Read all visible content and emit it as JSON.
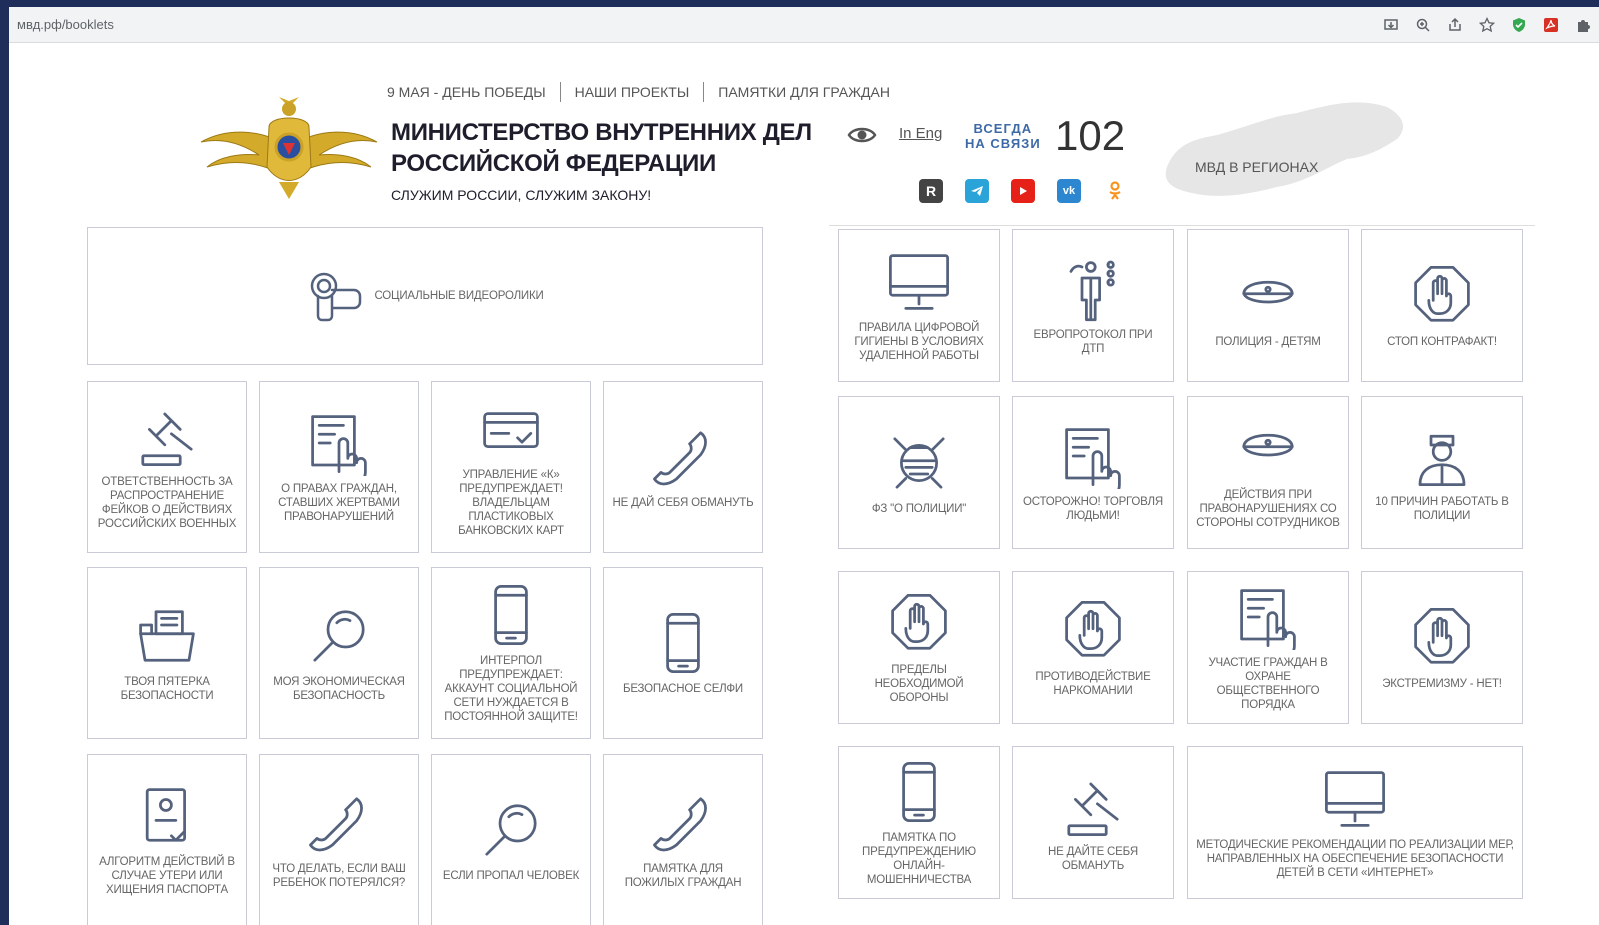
{
  "browser": {
    "url": "мвд.рф/booklets"
  },
  "header": {
    "nav": [
      "9 МАЯ - ДЕНЬ ПОБЕДЫ",
      "НАШИ ПРОЕКТЫ",
      "ПАМЯТКИ ДЛЯ ГРАЖДАН"
    ],
    "title_line1": "МИНИСТЕРСТВО ВНУТРЕННИХ ДЕЛ",
    "title_line2": "РОССИЙСКОЙ ФЕДЕРАЦИИ",
    "motto": "СЛУЖИМ РОССИИ, СЛУЖИМ ЗАКОНУ!",
    "lang_link": "In Eng",
    "always_line1": "ВСЕГДА",
    "always_line2": "НА СВЯЗИ",
    "phone": "102",
    "regions": "МВД В РЕГИОНАХ",
    "social": [
      "R",
      "telegram",
      "youtube",
      "vk",
      "ok"
    ]
  },
  "left": {
    "wide": "СОЦИАЛЬНЫЕ ВИДЕОРОЛИКИ",
    "tiles": [
      {
        "icon": "gavel-icon",
        "label": "ОТВЕТСТВЕННОСТЬ ЗА РАСПРОСТРАНЕНИЕ ФЕЙКОВ О ДЕЙСТВИЯХ РОССИЙСКИХ ВОЕННЫХ"
      },
      {
        "icon": "touch-document-icon",
        "label": "О ПРАВАХ ГРАЖДАН, СТАВШИХ ЖЕРТВАМИ ПРАВОНАРУШЕНИЙ"
      },
      {
        "icon": "bank-card-icon",
        "label": "УПРАВЛЕНИЕ «К» ПРЕДУПРЕЖДАЕТ! ВЛАДЕЛЬЦАМ ПЛАСТИКОВЫХ БАНКОВСКИХ КАРТ"
      },
      {
        "icon": "phone-handset-icon",
        "label": "НЕ ДАЙ СЕБЯ ОБМАНУТЬ"
      },
      {
        "icon": "folder-icon",
        "label": "ТВОЯ ПЯТЕРКА БЕЗОПАСНОСТИ"
      },
      {
        "icon": "magnifier-icon",
        "label": "МОЯ ЭКОНОМИЧЕСКАЯ БЕЗОПАСНОСТЬ"
      },
      {
        "icon": "smartphone-icon",
        "label": "ИНТЕРПОЛ ПРЕДУПРЕЖДАЕТ: АККАУНТ СОЦИАЛЬНОЙ СЕТИ НУЖДАЕТСЯ В ПОСТОЯННОЙ ЗАЩИТЕ!"
      },
      {
        "icon": "smartphone-icon",
        "label": "БЕЗОПАСНОЕ СЕЛФИ"
      },
      {
        "icon": "passport-icon",
        "label": "АЛГОРИТМ ДЕЙСТВИЙ В СЛУЧАЕ УТЕРИ ИЛИ ХИЩЕНИЯ ПАСПОРТА"
      },
      {
        "icon": "phone-handset-icon",
        "label": "ЧТО ДЕЛАТЬ, ЕСЛИ ВАШ РЕБЕНОК ПОТЕРЯЛСЯ?"
      },
      {
        "icon": "magnifier-icon",
        "label": "ЕСЛИ ПРОПАЛ ЧЕЛОВЕК"
      },
      {
        "icon": "phone-handset-icon",
        "label": "ПАМЯТКА ДЛЯ ПОЖИЛЫХ ГРАЖДАН"
      }
    ]
  },
  "right": {
    "tiles": [
      {
        "icon": "monitor-icon",
        "label": "ПРАВИЛА ЦИФРОВОЙ ГИГИЕНЫ В УСЛОВИЯХ УДАЛЕННОЙ РАБОТЫ"
      },
      {
        "icon": "traffic-officer-icon",
        "label": "ЕВРОПРОТОКОЛ ПРИ ДТП"
      },
      {
        "icon": "police-cap-icon",
        "label": "ПОЛИЦИЯ - ДЕТЯМ"
      },
      {
        "icon": "stop-hand-icon",
        "label": "СТОП КОНТРАФАКТ!"
      },
      {
        "icon": "police-shield-icon",
        "label": "ФЗ \"О ПОЛИЦИИ\""
      },
      {
        "icon": "touch-document-icon",
        "label": "ОСТОРОЖНО! ТОРГОВЛЯ ЛЮДЬМИ!"
      },
      {
        "icon": "police-cap-icon",
        "label": "ДЕЙСТВИЯ ПРИ ПРАВОНАРУШЕНИЯХ СО СТОРОНЫ СОТРУДНИКОВ"
      },
      {
        "icon": "police-officer-icon",
        "label": "10 ПРИЧИН РАБОТАТЬ В ПОЛИЦИИ"
      },
      {
        "icon": "stop-hand-icon",
        "label": "ПРЕДЕЛЫ НЕОБХОДИМОЙ ОБОРОНЫ"
      },
      {
        "icon": "stop-hand-icon",
        "label": "ПРОТИВОДЕЙСТВИЕ НАРКОМАНИИ"
      },
      {
        "icon": "touch-document-icon",
        "label": "УЧАСТИЕ ГРАЖДАН В ОХРАНЕ ОБЩЕСТВЕННОГО ПОРЯДКА"
      },
      {
        "icon": "stop-hand-icon",
        "label": "ЭКСТРЕМИЗМУ - НЕТ!"
      },
      {
        "icon": "smartphone-icon",
        "label": "ПАМЯТКА ПО ПРЕДУПРЕЖДЕНИЮ ОНЛАЙН-МОШЕННИЧЕСТВА"
      },
      {
        "icon": "gavel-icon",
        "label": "НЕ ДАЙТЕ СЕБЯ ОБМАНУТЬ"
      },
      {
        "icon": "monitor-icon",
        "label": "МЕТОДИЧЕСКИЕ РЕКОМЕНДАЦИИ ПО РЕАЛИЗАЦИИ МЕР, НАПРАВЛЕННЫХ НА ОБЕСПЕЧЕНИЕ БЕЗОПАСНОСТИ ДЕТЕЙ В СЕТИ «ИНТЕРНЕТ»"
      }
    ]
  },
  "colors": {
    "accent": "#3d6aa6",
    "icon": "#55627d",
    "border": "#c9ccd6",
    "frame": "#1f2d5a"
  }
}
